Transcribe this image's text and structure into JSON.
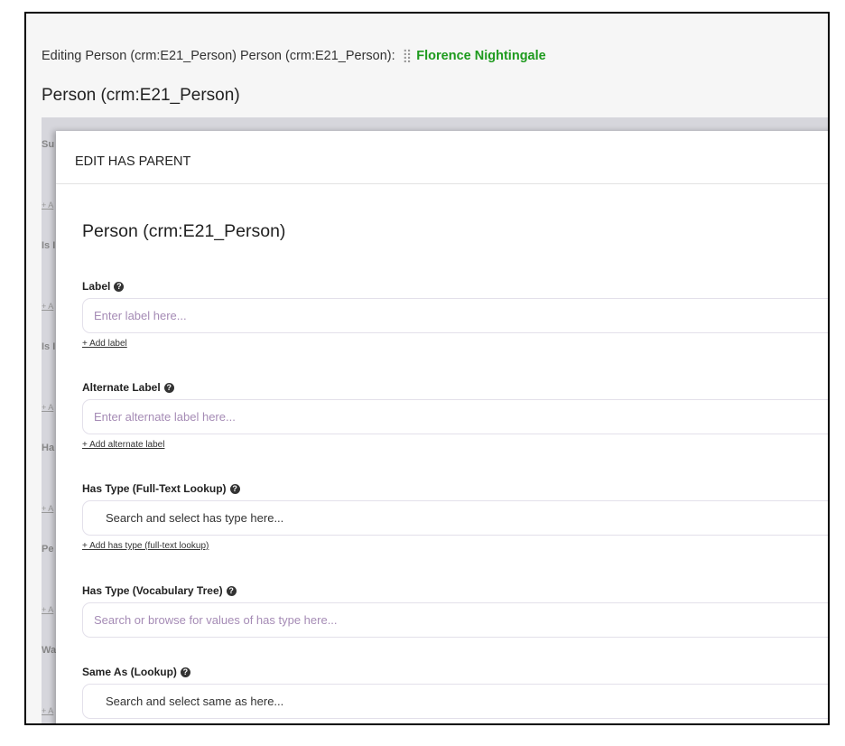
{
  "breadcrumb": {
    "prefix": "Editing Person (crm:E21_Person) Person (crm:E21_Person):",
    "grip": "⣿",
    "entity": "Florence Nightingale"
  },
  "page_title": "Person (crm:E21_Person)",
  "background_fields": {
    "labels": [
      "Su",
      "Is I",
      "Is I",
      "Ha",
      "Pe",
      "Wa"
    ],
    "add_link": "+ A"
  },
  "modal": {
    "header": "EDIT HAS PARENT",
    "title": "Person (crm:E21_Person)",
    "fields": [
      {
        "label": "Label",
        "placeholder": "Enter label here...",
        "add": "+ Add label",
        "kind": "text"
      },
      {
        "label": "Alternate Label",
        "placeholder": "Enter alternate label here...",
        "add": "+ Add alternate label",
        "kind": "text"
      },
      {
        "label": "Has Type (Full-Text Lookup)",
        "placeholder": "Search and select has type here...",
        "add": "+ Add has type (full-text lookup)",
        "kind": "select"
      },
      {
        "label": "Has Type (Vocabulary Tree)",
        "placeholder": "Search or browse for values of has type here...",
        "kind": "text"
      },
      {
        "label": "Same As (Lookup)",
        "placeholder": "Search and select same as here...",
        "kind": "select"
      }
    ],
    "help_icon": "question-circle-icon"
  },
  "colors": {
    "entity_link": "#1d9a1d",
    "placeholder": "#a58bb5"
  }
}
